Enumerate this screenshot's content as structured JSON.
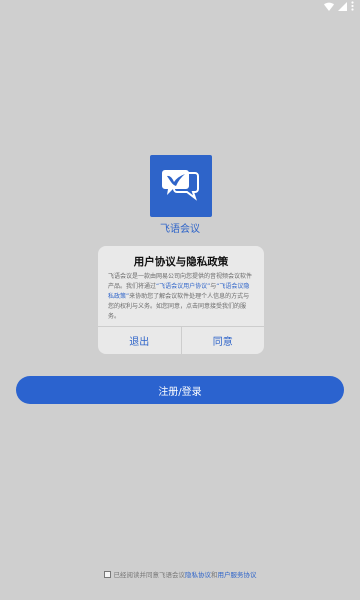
{
  "status_bar": {
    "icons": [
      "wifi-icon",
      "signal-icon",
      "more-icon"
    ]
  },
  "app": {
    "name": "飞语会议",
    "logo_color": "#2e64c9"
  },
  "dialog": {
    "title": "用户协议与隐私政策",
    "body_part1": "飞语会议是一款由网易公司向您提供的音视频会议软件产品。我们将通过",
    "link_user_agreement": "“飞语会议用户协议”",
    "body_connector": "与",
    "link_privacy_policy": "“飞语会议隐私政策”",
    "body_part2": "来协助您了解会议软件处理个人信息的方式与您的权利与义务。如您同意，点击同意接受我们的服务。",
    "cancel_label": "退出",
    "confirm_label": "同意"
  },
  "primary_button": {
    "label": "注册/登录",
    "color": "#2b63cf"
  },
  "agreement": {
    "prefix": "已经阅读并同意飞语会议",
    "privacy_link": "隐私协议",
    "connector": "和",
    "terms_link": "用户服务协议"
  }
}
